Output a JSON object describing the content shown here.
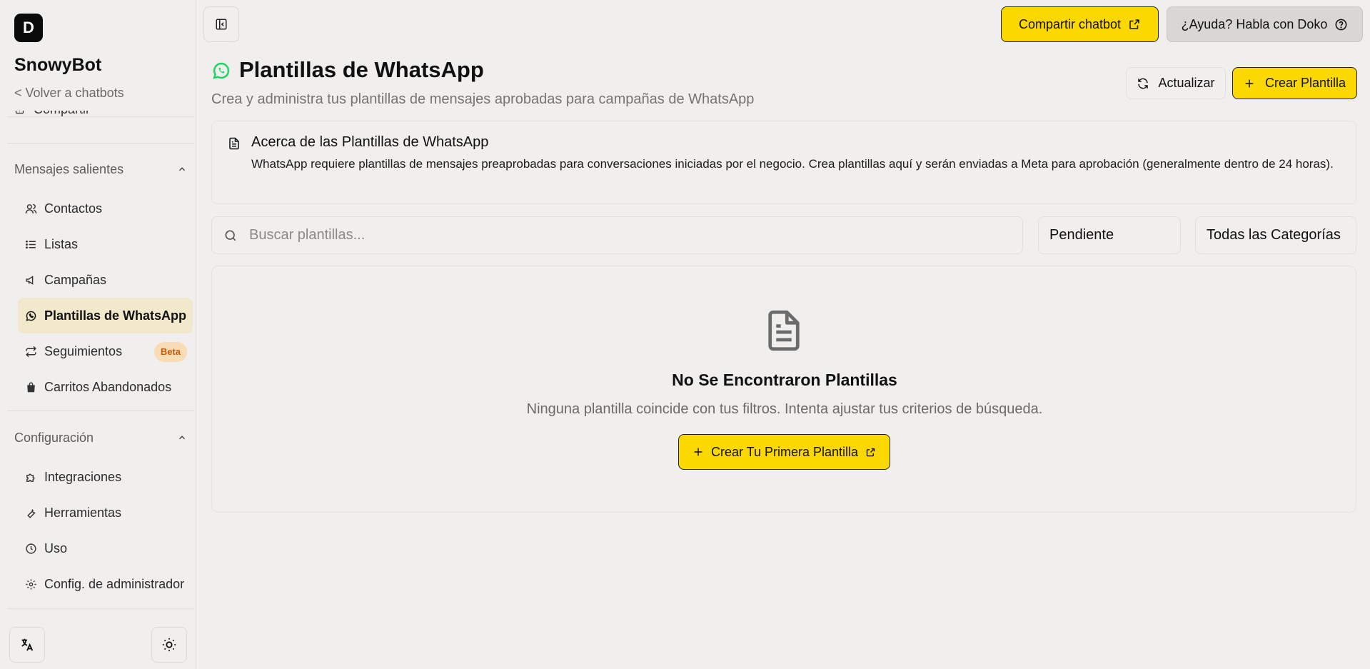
{
  "app": {
    "logo_letter": "D",
    "name": "SnowyBot",
    "back_link": "< Volver a chatbots"
  },
  "sidebar": {
    "partial_item": "Compartir",
    "sections": [
      {
        "title": "Mensajes salientes",
        "items": [
          {
            "label": "Contactos",
            "icon": "users-icon"
          },
          {
            "label": "Listas",
            "icon": "list-icon"
          },
          {
            "label": "Campañas",
            "icon": "megaphone-icon"
          },
          {
            "label": "Plantillas de WhatsApp",
            "icon": "whatsapp-icon",
            "active": true
          },
          {
            "label": "Seguimientos",
            "icon": "repeat-icon",
            "badge": "Beta"
          },
          {
            "label": "Carritos Abandonados",
            "icon": "shopping-bag-icon"
          }
        ]
      },
      {
        "title": "Configuración",
        "items": [
          {
            "label": "Integraciones",
            "icon": "puzzle-icon"
          },
          {
            "label": "Herramientas",
            "icon": "wrench-icon"
          },
          {
            "label": "Uso",
            "icon": "clock-icon"
          },
          {
            "label": "Config. de administrador",
            "icon": "gear-icon"
          }
        ]
      }
    ]
  },
  "topbar": {
    "share_label": "Compartir chatbot",
    "help_label": "¿Ayuda? Habla con Doko"
  },
  "page": {
    "title": "Plantillas de WhatsApp",
    "subtitle": "Crea y administra tus plantillas de mensajes aprobadas para campañas de WhatsApp",
    "refresh_label": "Actualizar",
    "create_label": "Crear Plantilla"
  },
  "info": {
    "title": "Acerca de las Plantillas de WhatsApp",
    "text": "WhatsApp requiere plantillas de mensajes preaprobadas para conversaciones iniciadas por el negocio. Crea plantillas aquí y serán enviadas a Meta para aprobación (generalmente dentro de 24 horas)."
  },
  "filters": {
    "search_placeholder": "Buscar plantillas...",
    "status_value": "Pendiente",
    "category_value": "Todas las Categorías"
  },
  "empty": {
    "title": "No Se Encontraron Plantillas",
    "text": "Ninguna plantilla coincide con tus filtros. Intenta ajustar tus criterios de búsqueda.",
    "button_label": "Crear Tu Primera Plantilla"
  },
  "colors": {
    "accent": "#fbd800",
    "background": "#f1efed",
    "active_nav": "#f2e9cd",
    "whatsapp_green": "#25d366",
    "beta_bg": "#f9dcb6",
    "beta_text": "#c25b0c"
  }
}
